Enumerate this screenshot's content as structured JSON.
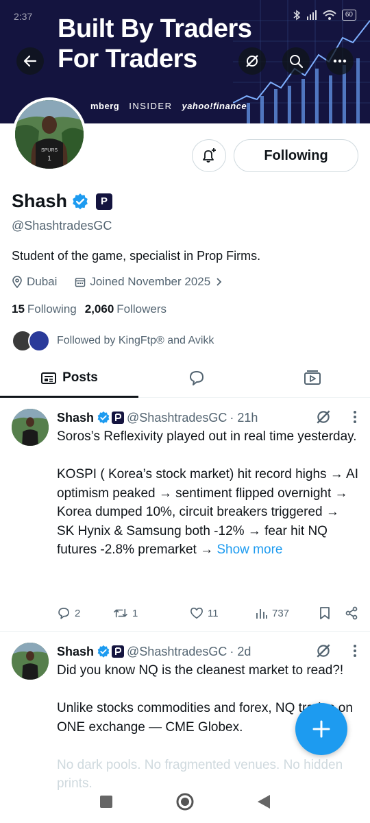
{
  "status_bar": {
    "time": "2:37",
    "battery": "60"
  },
  "banner": {
    "title_line1": "Built By Traders",
    "title_line2": "For Traders",
    "press": [
      "mberg",
      "INSIDER",
      "yahoo!finance"
    ]
  },
  "profile": {
    "display_name": "Shash",
    "affiliate_badge": "P",
    "handle": "@ShashtradesGC",
    "bio": "Student of the game, specialist in Prop Firms.",
    "location": "Dubai",
    "joined": "Joined November 2025",
    "following_count": "15",
    "following_label": "Following",
    "followers_count": "2,060",
    "followers_label": "Followers",
    "followed_by": "Followed by KingFtp® and Avikk",
    "follow_button": "Following"
  },
  "tabs": {
    "posts": "Posts"
  },
  "posts": [
    {
      "name": "Shash",
      "handle": "@ShashtradesGC",
      "time": "· 21h",
      "lines": [
        "Soros’s Reflexivity played out in real time yesterday.",
        "",
        "KOSPI ( Korea’s stock market) hit record highs → AI optimism peaked → sentiment flipped overnight → Korea dumped 10%, circuit breakers triggered → SK Hynix & Samsung both -12% → fear hit NQ futures -2.8% premarket →"
      ],
      "show_more": "Show more",
      "replies": "2",
      "reposts": "1",
      "likes": "11",
      "views": "737"
    },
    {
      "name": "Shash",
      "handle": "@ShashtradesGC",
      "time": "· 2d",
      "line1": "Did you know NQ is the cleanest market to read?!",
      "line2": "Unlike stocks commodities and forex, NQ trades on ONE exchange — CME Globex.",
      "line3": "No dark pools. No fragmented venues. No hidden prints."
    }
  ]
}
